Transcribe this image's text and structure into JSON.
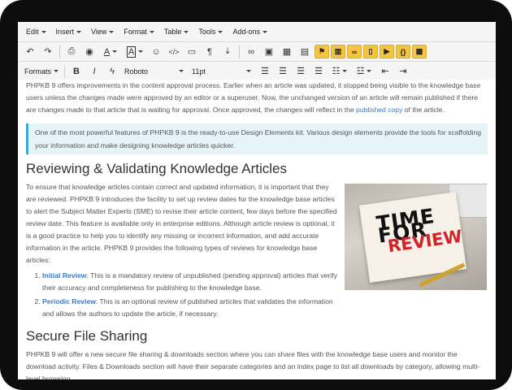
{
  "menubar": {
    "items": [
      "Edit",
      "Insert",
      "View",
      "Format",
      "Table",
      "Tools",
      "Add-ons"
    ]
  },
  "toolbar": {
    "font_name": "Roboto",
    "font_size": "11pt",
    "formats_label": "Formats",
    "bold": "B",
    "italic": "I",
    "text_color": "A",
    "bg_color": "A",
    "pilcrow": "¶",
    "code": "</>"
  },
  "content": {
    "intro": "PHPKB 9 offers improvements in the content approval process. Earlier when an article was updated, it stopped being visible to the knowledge base users unless the changes made were approved by an editor or a superuser. Now, the unchanged version of an article will remain published if there are changes made to that article that is waiting for approval. Once approved, the changes will reflect in the ",
    "intro_link": "published copy",
    "intro_end": " of the article.",
    "note": "One of the most powerful features of PHPKB 9 is the ready-to-use Design Elements kit. Various design elements provide the tools for scaffolding your information and make designing knowledge articles quicker.",
    "heading1": "Reviewing & Validating Knowledge Articles",
    "review_para": "To ensure that knowledge articles contain correct and updated information, it is important that they are reviewed. PHPKB 9 introduces the facility to set up review dates for the knowledge base articles to alert the Subject Matter Experts (SME) to revise their article content, few days before the specified review date. This feature is available only in enterprise editions. Although article review is optional, it is a good practice to help you to identify any missing or incorrect information, and add accurate information in the article. PHPKB 9 provides the following types of reviews for knowledge base articles:",
    "list": [
      {
        "title": "Initial Review",
        "text": ": This is a mandatory review of unpublished (pending approval) articles that verify their accuracy and completeness for publishing to the knowledge base."
      },
      {
        "title": "Periodic Review",
        "text": ": This is an optional review of published articles that validates the information and allows the authors to update the article, if necessary."
      }
    ],
    "image_text_1": "TIME FOR",
    "image_text_2": "REVIEW",
    "heading2": "Secure File Sharing",
    "share_para": "PHPKB 9 will offer a new secure file sharing & downloads section where you can share files with the knowledge base users and monitor the download activity. Files & Downloads section will have their separate categories and an index page to list all downloads by category, allowing multi-level browsing"
  }
}
